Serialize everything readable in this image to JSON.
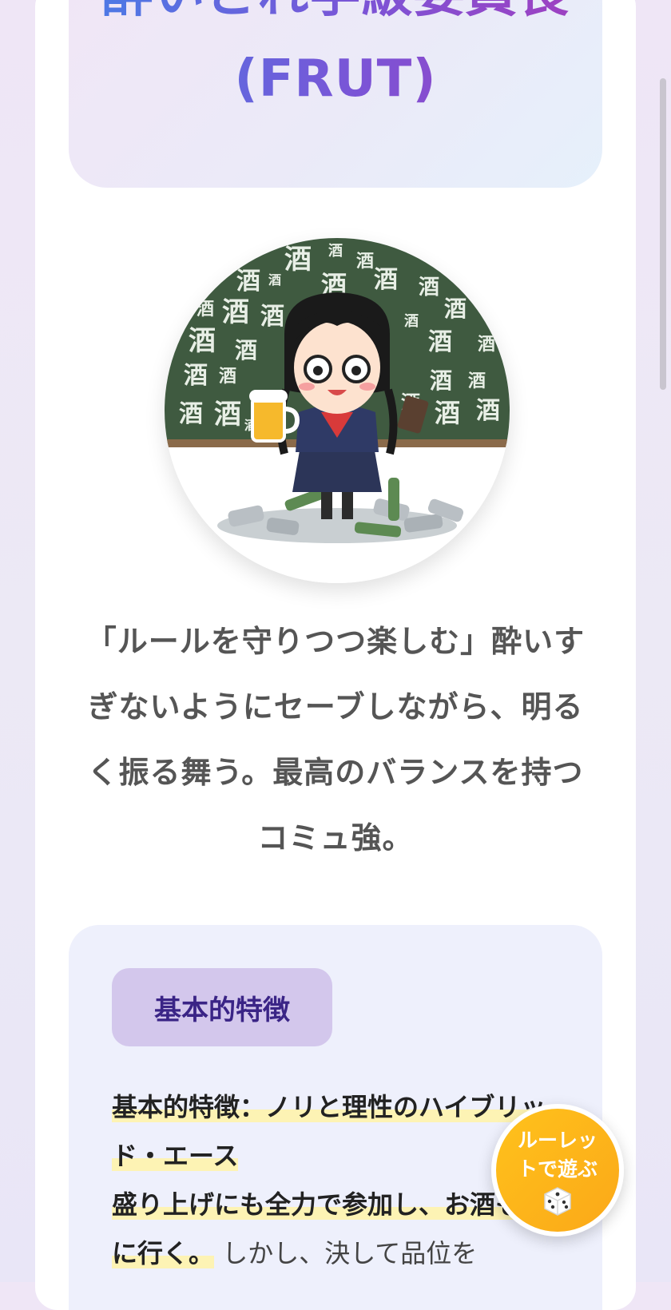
{
  "page": {
    "title": "酔いどれ学級委員長 (FRUT)",
    "description": "「ルールを守りつつ楽しむ」酔いすぎないようにセーブしながら、明るく振る舞う。最高のバランスを持つコミュ強。"
  },
  "avatar": {
    "chalkboard_text": "酒",
    "icon": "drunk-class-rep-illustration"
  },
  "features": {
    "badge": "基本的特徴",
    "line1": "基本的特徴：ノリと理性のハイブリッド・エース",
    "line2": "盛り上げにも全力で参加し、お酒も適度に行く。",
    "line3": "しかし、決して品位を"
  },
  "roulette": {
    "label": "ルーレットで遊ぶ",
    "icon": "dice-icon"
  },
  "colors": {
    "title_gradient_start": "#4a7be6",
    "title_gradient_end": "#a040c0",
    "badge_bg": "#d3c7ec",
    "badge_text": "#3a2486",
    "highlight": "#fdf3b4",
    "roulette_bg": "#ffc21c"
  }
}
